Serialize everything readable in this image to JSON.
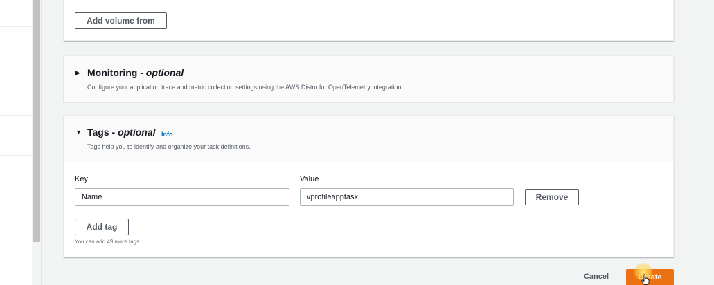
{
  "volumes": {
    "add_volume_from_label": "Add volume from"
  },
  "monitoring": {
    "title": "Monitoring - ",
    "title_optional": "optional",
    "description": "Configure your application trace and metric collection settings using the AWS Distro for OpenTelemetry integration.",
    "expanded": false
  },
  "tags": {
    "title": "Tags - ",
    "title_optional": "optional",
    "info_label": "Info",
    "description": "Tags help you to identify and organize your task definitions.",
    "key_label": "Key",
    "value_label": "Value",
    "rows": [
      {
        "key": "Name",
        "value": "vprofileapptask"
      }
    ],
    "remove_label": "Remove",
    "add_tag_label": "Add tag",
    "limit_hint": "You can add 49 more tags.",
    "expanded": true
  },
  "footer": {
    "cancel_label": "Cancel",
    "create_label": "Create"
  },
  "colors": {
    "primary": "#ec7211",
    "link": "#0073bb",
    "border": "#aab7b8"
  }
}
